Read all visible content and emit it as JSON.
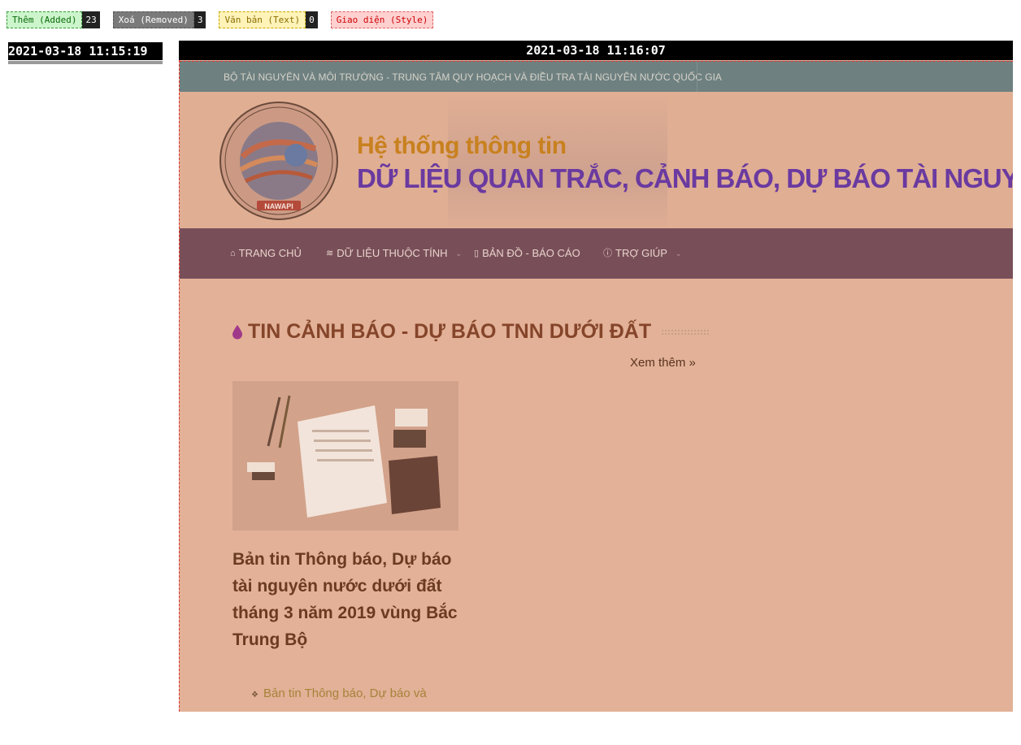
{
  "legend": {
    "added": {
      "label": "Thêm (Added)",
      "count": "23"
    },
    "removed": {
      "label": "Xoá (Removed)",
      "count": "3"
    },
    "text": {
      "label": "Văn bản (Text)",
      "count": "0"
    },
    "style": {
      "label": "Giao diện (Style)"
    }
  },
  "old_snapshot": {
    "timestamp": "2021-03-18 11:15:19"
  },
  "new_snapshot": {
    "timestamp": "2021-03-18 11:16:07"
  },
  "site": {
    "topbar": "BỘ TÀI NGUYÊN VÀ MÔI TRƯỜNG - TRUNG TÂM QUY HOẠCH VÀ ĐIỀU TRA TÀI NGUYÊN NƯỚC QUỐC GIA",
    "banner_title1": "Hệ thống thông tin",
    "banner_title2": "DỮ LIỆU QUAN TRẮC, CẢNH BÁO, DỰ BÁO TÀI NGUY",
    "logo_text": "NAWAPI",
    "nav": [
      {
        "label": "TRANG CHỦ",
        "icon": "home-icon"
      },
      {
        "label": "DỮ LIỆU THUỘC TÍNH",
        "icon": "database-icon"
      },
      {
        "label": "BẢN ĐỒ - BÁO CÁO",
        "icon": "map-icon"
      },
      {
        "label": "TRỢ GIÚP",
        "icon": "help-icon"
      }
    ],
    "section_title": "TIN CẢNH BÁO - DỰ BÁO TNN DƯỚI ĐẤT",
    "more_link": "Xem thêm »",
    "article_title": "Bản tin Thông báo, Dự báo tài nguyên nước dưới đất tháng 3 năm 2019 vùng Bắc Trung Bộ",
    "related_link": "Bản tin Thông báo, Dự báo và"
  },
  "colors": {
    "page_bg": "#e2b197",
    "topbar_bg": "#6e8080",
    "nav_bg": "#784f59",
    "title_accent": "#85452a",
    "banner_purple": "#6a3aa0",
    "banner_gold": "#c8811f"
  }
}
